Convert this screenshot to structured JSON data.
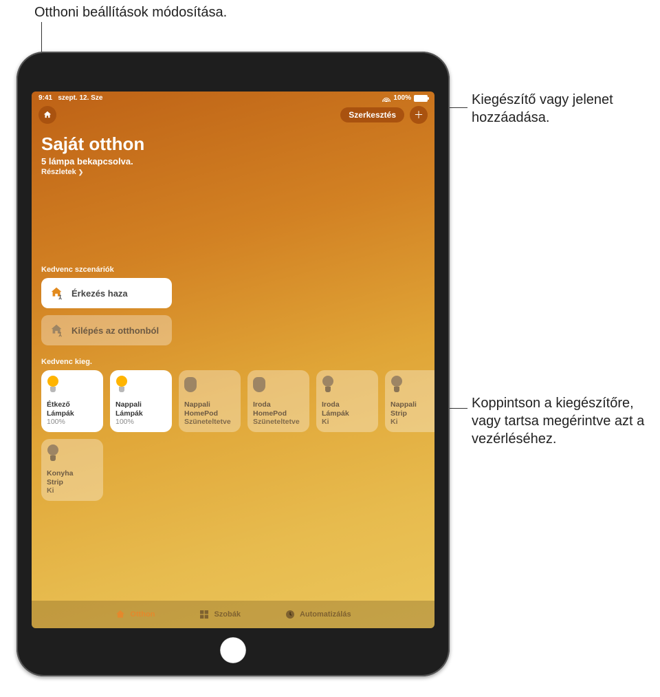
{
  "callouts": {
    "topLeft": "Otthoni beállítások módosítása.",
    "topRight": "Kiegészítő vagy jelenet hozzáadása.",
    "right": "Koppintson a kiegészítőre, vagy tartsa megérintve azt a vezérléséhez."
  },
  "status": {
    "time": "9:41",
    "date": "szept. 12. Sze",
    "battery": "100%"
  },
  "topnav": {
    "edit": "Szerkesztés",
    "plus": "＋"
  },
  "header": {
    "title": "Saját otthon",
    "subtitle": "5 lámpa bekapcsolva.",
    "details": "Részletek"
  },
  "sections": {
    "scenes": "Kedvenc szcenáriók",
    "accessories": "Kedvenc kieg."
  },
  "scenes": [
    {
      "label": "Érkezés haza",
      "active": true
    },
    {
      "label": "Kilépés az otthonból",
      "active": false
    }
  ],
  "accessories": [
    {
      "l1": "Étkező",
      "l2": "Lámpák",
      "l3": "100%",
      "type": "bulb",
      "on": true
    },
    {
      "l1": "Nappali",
      "l2": "Lámpák",
      "l3": "100%",
      "type": "bulb",
      "on": true
    },
    {
      "l1": "Nappali",
      "l2": "HomePod",
      "l3": "Szüneteltetve",
      "type": "pod",
      "on": false
    },
    {
      "l1": "Iroda",
      "l2": "HomePod",
      "l3": "Szüneteltetve",
      "type": "pod",
      "on": false
    },
    {
      "l1": "Iroda",
      "l2": "Lámpák",
      "l3": "Ki",
      "type": "bulb",
      "on": false
    },
    {
      "l1": "Nappali",
      "l2": "Strip",
      "l3": "Ki",
      "type": "bulb",
      "on": false
    },
    {
      "l1": "Konyha",
      "l2": "Strip",
      "l3": "Ki",
      "type": "bulb",
      "on": false
    }
  ],
  "tabs": [
    {
      "label": "Otthon",
      "active": true
    },
    {
      "label": "Szobák",
      "active": false
    },
    {
      "label": "Automatizálás",
      "active": false
    }
  ]
}
